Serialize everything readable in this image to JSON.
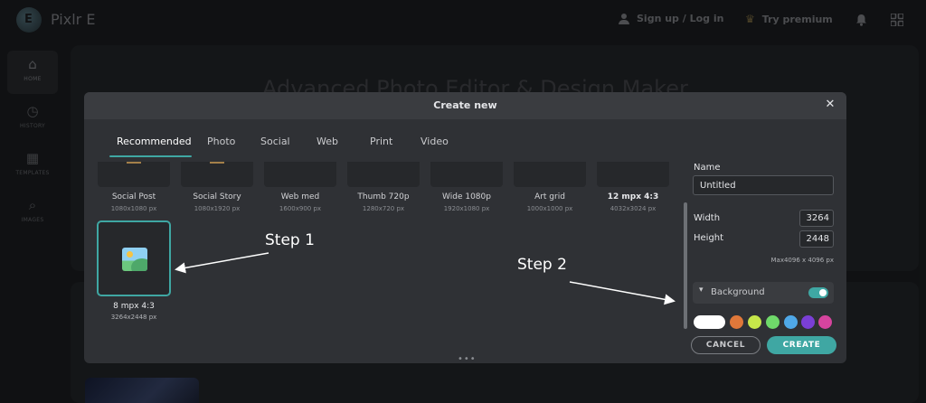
{
  "app": {
    "title": "Pixlr E",
    "logo_letter": "E"
  },
  "topbar": {
    "signup_label": "Sign up / Log in",
    "premium_label": "Try premium"
  },
  "sidebar": {
    "items": [
      {
        "label": "HOME"
      },
      {
        "label": "HISTORY"
      },
      {
        "label": "TEMPLATES"
      },
      {
        "label": "IMAGES"
      }
    ]
  },
  "background": {
    "headline": "Advanced Photo Editor & Design Maker"
  },
  "dialog": {
    "title": "Create new",
    "tabs": [
      "Recommended",
      "Photo",
      "Social",
      "Web",
      "Print",
      "Video"
    ],
    "presets": [
      {
        "name": "Social Post",
        "size": "1080x1080 px"
      },
      {
        "name": "Social Story",
        "size": "1080x1920 px"
      },
      {
        "name": "Web med",
        "size": "1600x900 px"
      },
      {
        "name": "Thumb 720p",
        "size": "1280x720 px"
      },
      {
        "name": "Wide 1080p",
        "size": "1920x1080 px"
      },
      {
        "name": "Art grid",
        "size": "1000x1000 px"
      },
      {
        "name": "12 mpx 4:3",
        "size": "4032x3024 px"
      }
    ],
    "selected_preset": {
      "name": "8 mpx 4:3",
      "size": "3264x2448 px"
    },
    "form": {
      "name_label": "Name",
      "name_value": "Untitled",
      "width_label": "Width",
      "width_value": "3264",
      "height_label": "Height",
      "height_value": "2448",
      "max_note": "Max4096 x 4096 px",
      "background_label": "Background",
      "background_enabled": true,
      "swatches": [
        "#ffffff",
        "#e0783a",
        "#c6e64a",
        "#6fd96a",
        "#4fa8e8",
        "#7a3fd6",
        "#d6449e"
      ]
    },
    "cancel_label": "CANCEL",
    "create_label": "CREATE",
    "drag_handle": "•••"
  },
  "annotations": {
    "step1": "Step 1",
    "step2": "Step 2"
  },
  "colors": {
    "accent": "#3fa7a3",
    "modal_bg": "#2f3135",
    "page_bg": "#1e2023"
  }
}
